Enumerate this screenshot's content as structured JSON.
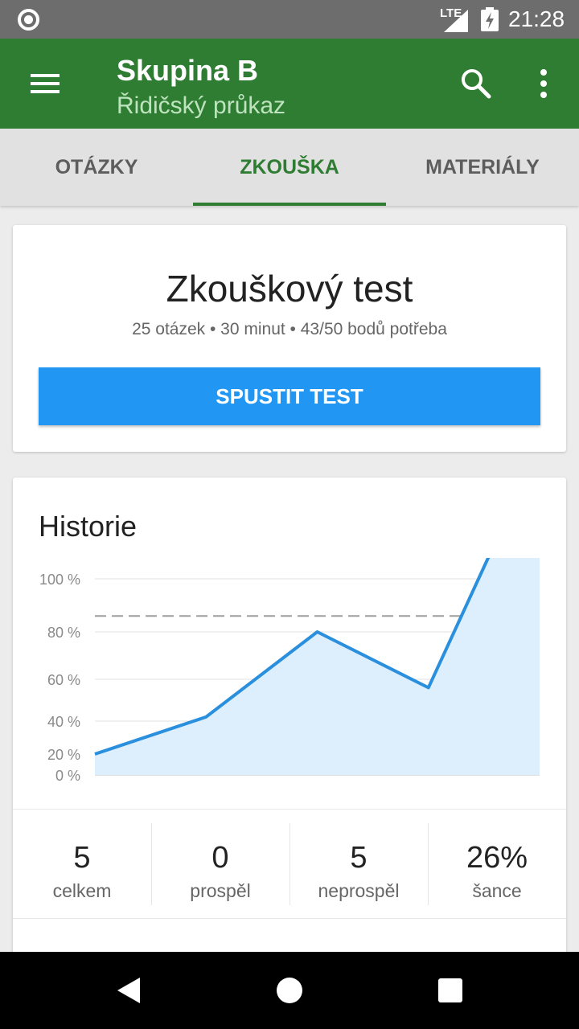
{
  "status_bar": {
    "network": "LTE",
    "time": "21:28"
  },
  "app_bar": {
    "title": "Skupina B",
    "subtitle": "Řidičský průkaz"
  },
  "tabs": [
    {
      "label": "OTÁZKY",
      "active": false
    },
    {
      "label": "ZKOUŠKA",
      "active": true
    },
    {
      "label": "MATERIÁLY",
      "active": false
    }
  ],
  "test_card": {
    "title": "Zkouškový test",
    "meta": "25 otázek • 30 minut • 43/50 bodů potřeba",
    "start_label": "SPUSTIT TEST"
  },
  "history": {
    "title": "Historie",
    "stats": [
      {
        "value": "5",
        "label": "celkem"
      },
      {
        "value": "0",
        "label": "prospěl"
      },
      {
        "value": "5",
        "label": "neprospěl"
      },
      {
        "value": "26%",
        "label": "šance"
      }
    ]
  },
  "chart_data": {
    "type": "area",
    "title": "",
    "xlabel": "",
    "ylabel": "",
    "ylim": [
      0,
      100
    ],
    "y_ticks": [
      "0 %",
      "20 %",
      "40 %",
      "60 %",
      "80 %",
      "100 %"
    ],
    "x": [
      1,
      2,
      3,
      4,
      5
    ],
    "values": [
      20,
      42,
      80,
      56,
      150
    ],
    "threshold": 86,
    "colors": {
      "line": "#2a8fdc",
      "fill": "#ddeefc",
      "threshold": "#9e9e9e",
      "grid": "#e0e0e0"
    }
  },
  "colors": {
    "primary": "#2e7d32",
    "accent": "#2196f3"
  }
}
